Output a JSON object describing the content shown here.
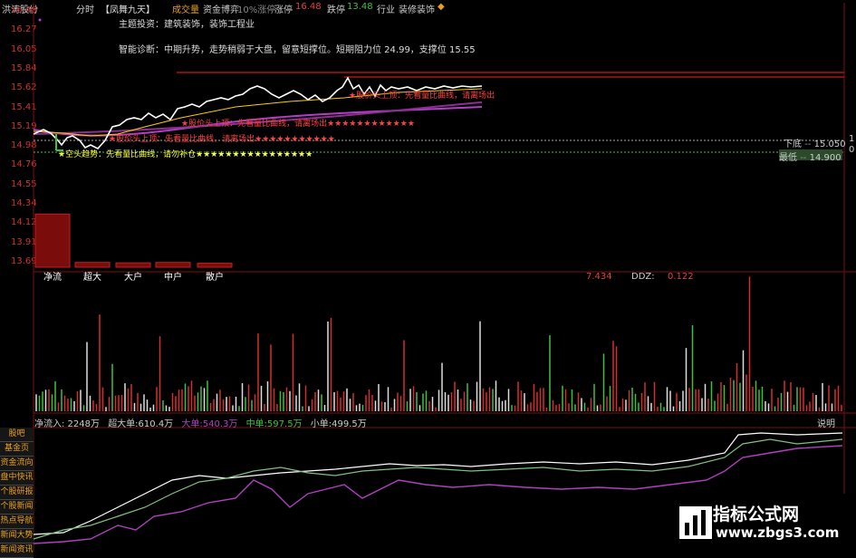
{
  "header": {
    "stock_name": "洪涛股份",
    "mode": "分时",
    "indicator": "【凤舞九天】",
    "metric_a": "成交量",
    "metric_b": "资金博弈",
    "metric_c": "10%涨停",
    "limit_up_label": "涨停",
    "limit_up_value": "16.48",
    "limit_down_label": "跌停",
    "limit_down_value": "13.48",
    "industry_label": "行业",
    "industry_value": "装修装饰"
  },
  "info": {
    "theme": "主题投资：建筑装饰，装饰工程业",
    "diagnosis": "智能诊断：中期升势，走势稍弱于大盘，留意短撑位。短期阻力位 24.99，支撑位 15.55"
  },
  "price_axis": [
    "16.48",
    "16.27",
    "16.05",
    "15.84",
    "15.62",
    "15.41",
    "15.19",
    "14.98",
    "14.76",
    "14.55",
    "14.34",
    "14.12",
    "13.91",
    "13.69"
  ],
  "right_axis": [
    "1",
    "0"
  ],
  "signals": [
    "★股价头上顶：先看量比曲线，请离场出★★★★★★★★★★★★",
    "★股价头上顶：先看量比曲线，请离场出★★★★★★★★★★★",
    "★股价头上顶：先看量比曲线，请离场出",
    "★空头趋势：先看量比曲线，请勿补仓★★★★★★★★★★★★★★★★"
  ],
  "levels": {
    "lower_label": "下底",
    "lower_value": "15.050",
    "upper_label": "最低",
    "upper_value": "14.900"
  },
  "fund_bars": {
    "labels": [
      "净流",
      "超大",
      "大户",
      "中户",
      "散户"
    ],
    "values": [
      13.35,
      1.2,
      1.1,
      1.2,
      1.0
    ]
  },
  "ddz": {
    "left_value": "7.434",
    "label": "DDZ:",
    "value": "0.122"
  },
  "flow": {
    "net": "净流入: 2248万",
    "super": "超大单:610.4万",
    "large": "大单:540.3万",
    "medium": "中单:597.5万",
    "small": "小单:499.5万",
    "help": "说明"
  },
  "sidebar": [
    "股吧",
    "基金页",
    "资金流向",
    "盘中快讯",
    "个股研报",
    "个股新闻",
    "热点导航",
    "新闻大势",
    "新闻资讯"
  ],
  "watermark": {
    "title": "指标公式网",
    "url": "www.zbgs3.com"
  },
  "colors": {
    "price_line": "#ffffff",
    "avg_line": "#ffcc00",
    "ma_purple": "#b040c0",
    "limit_red": "#ff2020",
    "volume_red": "#d03030",
    "volume_green": "#40c040",
    "signal_red": "#ff4040",
    "signal_yellow": "#ffff40",
    "accent_orange": "#e8a020"
  }
}
